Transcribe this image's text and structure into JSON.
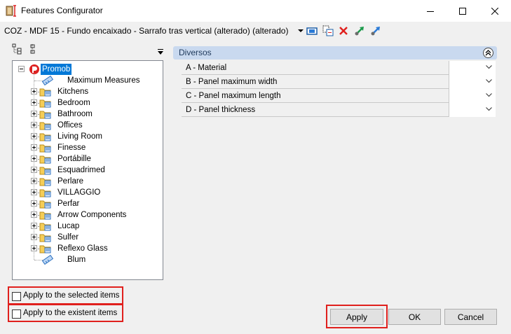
{
  "window": {
    "title": "Features Configurator"
  },
  "item_line": "COZ - MDF 15 - Fundo encaixado - Sarrafo tras vertical (alterado) (alterado)",
  "toolbar": {
    "icons": [
      "dropdown-arrow-icon",
      "select-item-icon",
      "add-to-selection-icon",
      "delete-x-icon",
      "green-arrow-icon",
      "blue-arrow-icon"
    ]
  },
  "tree": {
    "root": {
      "label": "Promob",
      "selected": true,
      "expanded": true
    },
    "children": [
      {
        "label": "Maximum Measures",
        "expandable": false,
        "icon": "measure-icon"
      },
      {
        "label": "Kitchens",
        "expandable": true,
        "icon": "folder-icon"
      },
      {
        "label": "Bedroom",
        "expandable": true,
        "icon": "folder-icon"
      },
      {
        "label": "Bathroom",
        "expandable": true,
        "icon": "folder-icon"
      },
      {
        "label": "Offices",
        "expandable": true,
        "icon": "folder-icon"
      },
      {
        "label": "Living Room",
        "expandable": true,
        "icon": "folder-icon"
      },
      {
        "label": "Finesse",
        "expandable": true,
        "icon": "folder-icon"
      },
      {
        "label": "Portábille",
        "expandable": true,
        "icon": "folder-icon"
      },
      {
        "label": "Esquadrimed",
        "expandable": true,
        "icon": "folder-icon"
      },
      {
        "label": "Perlare",
        "expandable": true,
        "icon": "folder-icon"
      },
      {
        "label": "VILLAGGIO",
        "expandable": true,
        "icon": "folder-icon"
      },
      {
        "label": "Perfar",
        "expandable": true,
        "icon": "folder-icon"
      },
      {
        "label": "Arrow Components",
        "expandable": true,
        "icon": "folder-icon"
      },
      {
        "label": "Lucap",
        "expandable": true,
        "icon": "folder-icon"
      },
      {
        "label": "Sulfer",
        "expandable": true,
        "icon": "folder-icon"
      },
      {
        "label": "Reflexo Glass",
        "expandable": true,
        "icon": "folder-icon"
      },
      {
        "label": "Blum",
        "expandable": false,
        "icon": "measure-icon"
      }
    ]
  },
  "group": {
    "title": "Diversos",
    "properties": [
      {
        "label": "A - Material",
        "value": ""
      },
      {
        "label": "B - Panel maximum width",
        "value": ""
      },
      {
        "label": "C - Panel maximum length",
        "value": ""
      },
      {
        "label": "D - Panel thickness",
        "value": ""
      }
    ]
  },
  "options": {
    "apply_selected": {
      "label": "Apply to the selected items",
      "checked": false
    },
    "apply_existent": {
      "label": "Apply to the existent items",
      "checked": false
    }
  },
  "buttons": {
    "apply": "Apply",
    "ok": "OK",
    "cancel": "Cancel"
  },
  "colors": {
    "selection": "#0078d7",
    "group_header": "#c9d9ef",
    "highlight_outline": "#e0201d"
  }
}
